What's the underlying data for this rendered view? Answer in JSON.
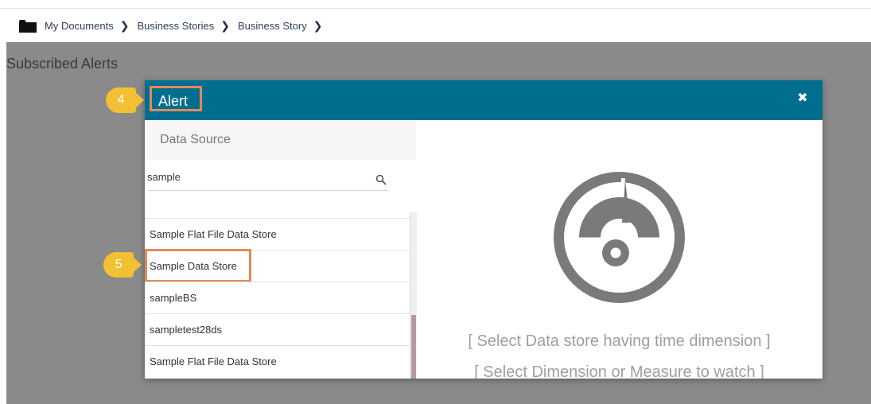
{
  "breadcrumb": {
    "items": [
      "My Documents",
      "Business Stories",
      "Business Story"
    ],
    "separator": "❯"
  },
  "page": {
    "title": "Subscribed Alerts"
  },
  "modal": {
    "title": "Alert",
    "close_icon": "close-icon",
    "header_color": "#006e8f"
  },
  "data_source": {
    "header": "Data Source",
    "search_value": "sample",
    "items": [
      "Sample Flat File Data Store",
      "Sample Data Store",
      "sampleBS",
      "sampletest28ds",
      "Sample Flat File Data Store"
    ]
  },
  "hints": {
    "line1": "[ Select Data store having time dimension ]",
    "line2": "[ Select Dimension or Measure to watch ]"
  },
  "callouts": {
    "step4": "4",
    "step5": "5",
    "color": "#f2c032"
  }
}
